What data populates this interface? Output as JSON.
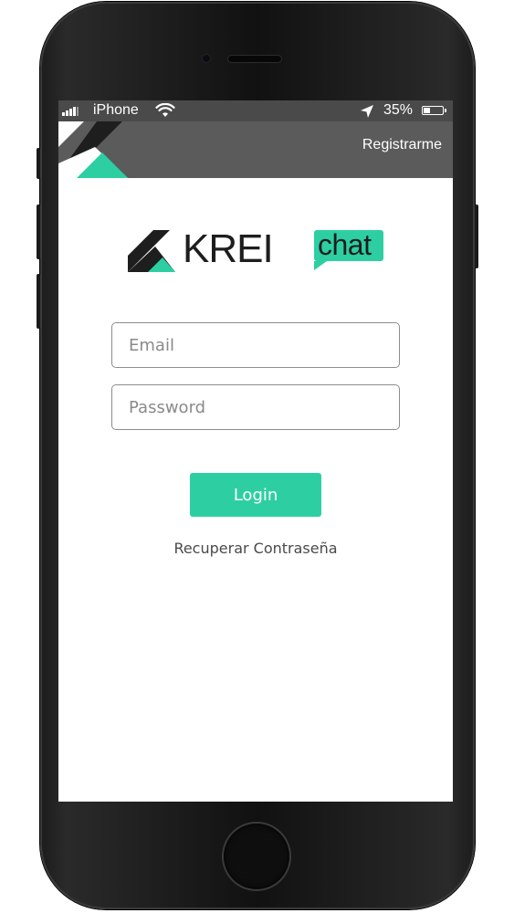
{
  "status_bar": {
    "carrier": "iPhone",
    "battery_percent_text": "35%",
    "battery_level": 0.35,
    "signal_icon": "signal-bars-icon",
    "wifi_icon": "wifi-icon",
    "location_icon": "location-arrow-icon",
    "battery_icon": "battery-icon"
  },
  "header": {
    "register_label": "Registrarme"
  },
  "logo": {
    "word": "KREI",
    "bubble_text": "chat"
  },
  "form": {
    "email": {
      "placeholder": "Email",
      "value": ""
    },
    "password": {
      "placeholder": "Password",
      "value": ""
    },
    "login_label": "Login",
    "recover_label": "Recuperar Contraseña"
  },
  "colors": {
    "accent": "#2dcfa2",
    "header_bg": "#5b5b5b",
    "status_bg": "#4a4a4a",
    "logo_dark": "#1e1e1e"
  }
}
